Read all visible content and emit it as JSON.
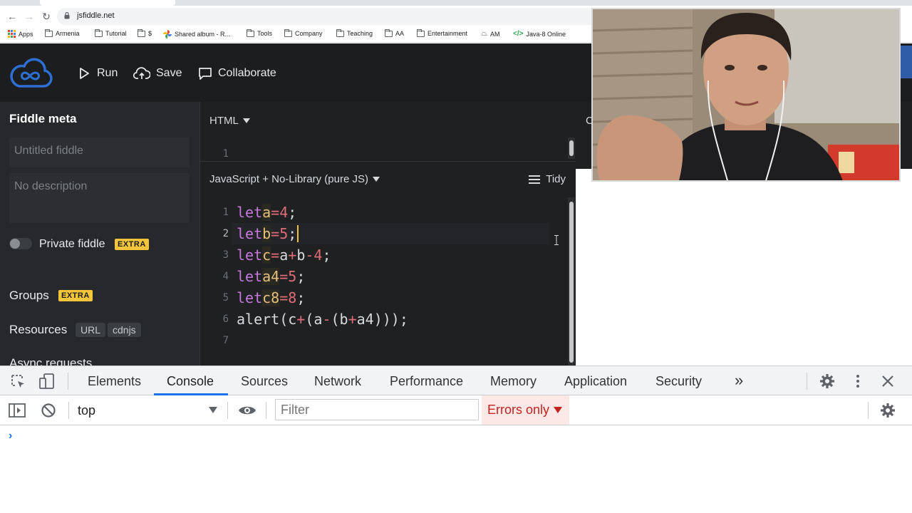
{
  "browser": {
    "url": "jsfiddle.net",
    "bookmarks": [
      {
        "label": "Apps"
      },
      {
        "label": "Armenia"
      },
      {
        "label": "Tutorial"
      },
      {
        "label": "$"
      },
      {
        "label": "Shared album - R..."
      },
      {
        "label": "Tools"
      },
      {
        "label": "Company"
      },
      {
        "label": "Teaching"
      },
      {
        "label": "AA"
      },
      {
        "label": "Entertainment"
      },
      {
        "label": "AM"
      },
      {
        "label": "Java-8 Online"
      }
    ]
  },
  "header": {
    "run_label": "Run",
    "save_label": "Save",
    "collaborate_label": "Collaborate"
  },
  "sidebar": {
    "title": "Fiddle meta",
    "title_placeholder": "Untitled fiddle",
    "description_placeholder": "No description",
    "private_label": "Private fiddle",
    "extra_badge": "EXTRA",
    "groups_label": "Groups",
    "resources_label": "Resources",
    "resource_url": "URL",
    "resource_cdnjs": "cdnjs",
    "async_label": "Async requests"
  },
  "html_panel": {
    "label": "HTML",
    "line_number": "1"
  },
  "js_panel": {
    "label": "JavaScript + No-Library (pure JS)",
    "tidy_label": "Tidy",
    "lines": [
      {
        "n": "1",
        "code": "let a = 4;"
      },
      {
        "n": "2",
        "code": "let b = 5;"
      },
      {
        "n": "3",
        "code": "let c = a + b - 4;"
      },
      {
        "n": "4",
        "code": "let a4 = 5;"
      },
      {
        "n": "5",
        "code": "let c8 = 8;"
      },
      {
        "n": "6",
        "code": "alert(c + (a - (b + a4)));"
      },
      {
        "n": "7",
        "code": ""
      }
    ],
    "tokens": {
      "l1": [
        "let",
        "a",
        "=",
        "4",
        ";"
      ],
      "l2": [
        "let",
        "b",
        "=",
        "5",
        ";"
      ],
      "l3": [
        "let",
        "c",
        "=",
        "a",
        "+",
        "b",
        "-",
        "4",
        ";"
      ],
      "l4": [
        "let",
        "a4",
        "=",
        "5",
        ";"
      ],
      "l5": [
        "let",
        "c8",
        "=",
        "8",
        ";"
      ],
      "l6": [
        "alert(c",
        "+",
        "(a",
        "-",
        "(b",
        "+",
        "a4)));"
      ]
    }
  },
  "result_panel": {
    "label": "C"
  },
  "devtools": {
    "tabs": [
      "Elements",
      "Console",
      "Sources",
      "Network",
      "Performance",
      "Memory",
      "Application",
      "Security"
    ],
    "active_tab": "Console",
    "more_label": "»",
    "context": "top",
    "filter_placeholder": "Filter",
    "levels_label": "Errors only",
    "prompt": "›"
  },
  "colors": {
    "accent": "#1a73e8",
    "extra_badge": "#f4c53a",
    "keyword": "#c678dd",
    "variable": "#e5c07b",
    "number_operator": "#e06c75"
  }
}
